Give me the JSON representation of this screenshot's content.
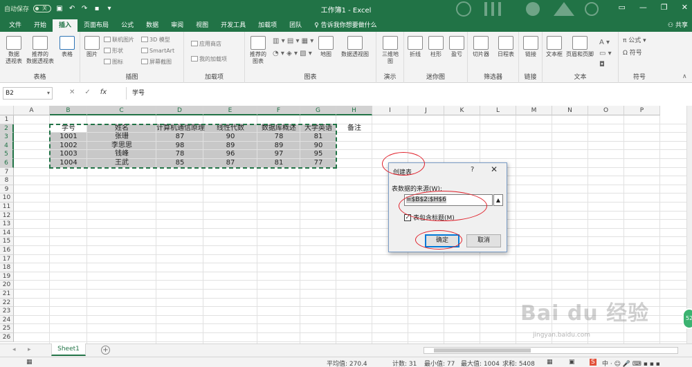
{
  "title_bar": {
    "autosave_label": "自动保存",
    "autosave_state": "关",
    "doc_title": "工作簿1 - Excel"
  },
  "tabs": [
    "文件",
    "开始",
    "插入",
    "页面布局",
    "公式",
    "数据",
    "审阅",
    "视图",
    "开发工具",
    "加载项",
    "团队"
  ],
  "active_tab": "插入",
  "tell_me": "告诉我你想要做什么",
  "share": "共享",
  "ribbon": {
    "tables": {
      "label": "表格",
      "pivot": "数据\n透视表",
      "recommended_pivot": "推荐的\n数据透视表",
      "table": "表格"
    },
    "illustrations": {
      "label": "插图",
      "pictures": "图片",
      "online_pictures": "联机图片",
      "shapes": "形状",
      "icons": "图标",
      "model3d": "3D 模型",
      "smartart": "SmartArt",
      "screenshot": "屏幕截图"
    },
    "addins": {
      "label": "加载项",
      "store": "应用商店",
      "my_addins": "我的加载项"
    },
    "charts": {
      "label": "图表",
      "recommended": "推荐的\n图表",
      "maps": "地图",
      "pivot_chart": "数据透视图"
    },
    "tours": {
      "label": "演示",
      "map3d": "三维地\n图"
    },
    "sparklines": {
      "label": "迷你图",
      "line": "折线",
      "column": "柱形",
      "winloss": "盈亏"
    },
    "filters": {
      "label": "筛选器",
      "slicer": "切片器",
      "timeline": "日程表"
    },
    "links": {
      "label": "链接",
      "link": "链接"
    },
    "text": {
      "label": "文本",
      "textbox": "文本框",
      "header_footer": "页眉和页脚"
    },
    "symbols": {
      "label": "符号",
      "equation": "公式",
      "symbol": "符号"
    }
  },
  "formula_bar": {
    "name_box": "B2",
    "content": "学号"
  },
  "columns": [
    "A",
    "B",
    "C",
    "D",
    "E",
    "F",
    "G",
    "H",
    "I",
    "J",
    "K",
    "L",
    "M",
    "N",
    "O",
    "P"
  ],
  "rows": [
    "1",
    "2",
    "3",
    "4",
    "5",
    "6",
    "7",
    "8",
    "9",
    "10",
    "11",
    "12",
    "13",
    "14",
    "15",
    "16",
    "17",
    "18",
    "19",
    "20",
    "21",
    "22",
    "23",
    "24",
    "25",
    "26"
  ],
  "table": {
    "headers": [
      "学号",
      "姓名",
      "计算机通信原理",
      "线性代数",
      "数据库概述",
      "大学英语",
      "备注"
    ],
    "rows": [
      [
        "1001",
        "张珊",
        "87",
        "90",
        "78",
        "81",
        ""
      ],
      [
        "1002",
        "李思思",
        "98",
        "89",
        "89",
        "90",
        ""
      ],
      [
        "1003",
        "钱峰",
        "78",
        "96",
        "97",
        "95",
        ""
      ],
      [
        "1004",
        "王武",
        "85",
        "87",
        "81",
        "77",
        ""
      ]
    ]
  },
  "dialog": {
    "title": "创建表",
    "help": "?",
    "close": "✕",
    "source_label": "表数据的来源(W):",
    "source_value": "=$B$2:$H$6",
    "has_headers_label": "表包含标题(M)",
    "has_headers_checked": true,
    "ok": "确定",
    "cancel": "取消"
  },
  "sheet_tabs": [
    "Sheet1"
  ],
  "add_sheet": "⊕",
  "status": {
    "average": "平均值: 270.4",
    "count": "计数: 31",
    "min": "最小值: 77",
    "max": "最大值: 1004",
    "sum": "求和: 5408"
  },
  "watermark": "Bai du 经验",
  "watermark_url": "jingyan.baidu.com",
  "colors": {
    "excel_green": "#217346",
    "selection_gray": "#c8c8c8",
    "annotation_red": "#e0202a"
  }
}
